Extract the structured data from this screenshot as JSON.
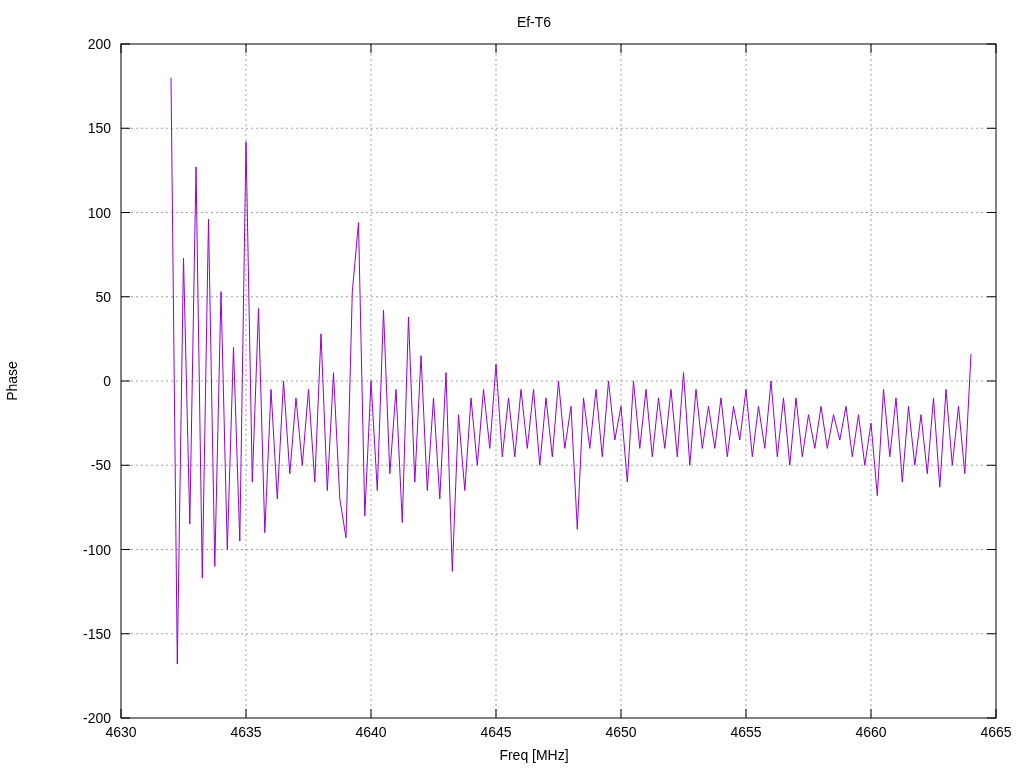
{
  "chart_data": {
    "type": "line",
    "title": "Ef-T6",
    "xlabel": "Freq [MHz]",
    "ylabel": "Phase",
    "grid": true,
    "xlim": [
      4630,
      4665
    ],
    "ylim": [
      -200,
      200
    ],
    "xticks": [
      4630,
      4635,
      4640,
      4645,
      4650,
      4655,
      4660,
      4665
    ],
    "yticks": [
      -200,
      -150,
      -100,
      -50,
      0,
      50,
      100,
      150,
      200
    ],
    "x": [
      4632,
      4632.25,
      4632.5,
      4632.75,
      4633,
      4633.25,
      4633.5,
      4633.75,
      4634,
      4634.25,
      4634.5,
      4634.75,
      4635,
      4635.25,
      4635.5,
      4635.75,
      4636,
      4636.25,
      4636.5,
      4636.75,
      4637,
      4637.25,
      4637.5,
      4637.75,
      4638,
      4638.25,
      4638.5,
      4638.75,
      4639,
      4639.25,
      4639.5,
      4639.75,
      4640,
      4640.25,
      4640.5,
      4640.75,
      4641,
      4641.25,
      4641.5,
      4641.75,
      4642,
      4642.25,
      4642.5,
      4642.75,
      4643,
      4643.25,
      4643.5,
      4643.75,
      4644,
      4644.25,
      4644.5,
      4644.75,
      4645,
      4645.25,
      4645.5,
      4645.75,
      4646,
      4646.25,
      4646.5,
      4646.75,
      4647,
      4647.25,
      4647.5,
      4647.75,
      4648,
      4648.25,
      4648.5,
      4648.75,
      4649,
      4649.25,
      4649.5,
      4649.75,
      4650,
      4650.25,
      4650.5,
      4650.75,
      4651,
      4651.25,
      4651.5,
      4651.75,
      4652,
      4652.25,
      4652.5,
      4652.75,
      4653,
      4653.25,
      4653.5,
      4653.75,
      4654,
      4654.25,
      4654.5,
      4654.75,
      4655,
      4655.25,
      4655.5,
      4655.75,
      4656,
      4656.25,
      4656.5,
      4656.75,
      4657,
      4657.25,
      4657.5,
      4657.75,
      4658,
      4658.25,
      4658.5,
      4658.75,
      4659,
      4659.25,
      4659.5,
      4659.75,
      4660,
      4660.25,
      4660.5,
      4660.75,
      4661,
      4661.25,
      4661.5,
      4661.75,
      4662,
      4662.25,
      4662.5,
      4662.75,
      4663,
      4663.25,
      4663.5,
      4663.75,
      4664
    ],
    "series": [
      {
        "color": "#9400d3",
        "values": [
          180,
          -168,
          73,
          -85,
          127,
          -117,
          96,
          -110,
          53,
          -100,
          20,
          -95,
          142,
          -60,
          43,
          -90,
          -5,
          -70,
          0,
          -55,
          -10,
          -50,
          -5,
          -60,
          28,
          -65,
          5,
          -70,
          -93,
          53,
          94,
          -80,
          0,
          -65,
          42,
          -55,
          -5,
          -84,
          38,
          -60,
          15,
          -65,
          -10,
          -70,
          5,
          -113,
          -20,
          -65,
          -10,
          -50,
          -5,
          -40,
          10,
          -45,
          -10,
          -45,
          -5,
          -40,
          -5,
          -50,
          -10,
          -45,
          0,
          -40,
          -15,
          -88,
          -10,
          -40,
          -5,
          -45,
          0,
          -35,
          -15,
          -60,
          0,
          -40,
          -5,
          -45,
          -10,
          -40,
          -5,
          -45,
          5,
          -50,
          -5,
          -40,
          -15,
          -40,
          -10,
          -45,
          -15,
          -35,
          -5,
          -45,
          -15,
          -40,
          0,
          -45,
          -10,
          -50,
          -10,
          -45,
          -20,
          -40,
          -15,
          -40,
          -20,
          -35,
          -15,
          -45,
          -20,
          -50,
          -25,
          -68,
          -5,
          -45,
          -10,
          -60,
          -15,
          -50,
          -20,
          -55,
          -10,
          -63,
          -5,
          -50,
          -15,
          -55,
          16
        ]
      }
    ]
  }
}
